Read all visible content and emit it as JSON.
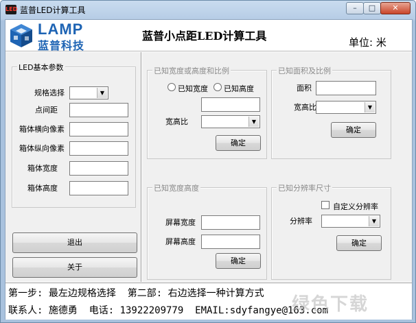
{
  "window": {
    "title": "蓝普LED计算工具",
    "icon_text": "LED",
    "controls": {
      "minimize": "–",
      "maximize": "□",
      "close": "✕"
    }
  },
  "header": {
    "logo_en": "LAMP",
    "logo_cn": "蓝普科技",
    "app_title": "蓝普小点距LED计算工具",
    "unit": "单位: 米"
  },
  "led_params": {
    "title": "LED基本参数",
    "spec_label": "规格选择",
    "spec_value": "",
    "pitch_label": "点间距",
    "pitch_value": "",
    "h_pixels_label": "箱体横向像素",
    "h_pixels_value": "",
    "v_pixels_label": "箱体纵向像素",
    "v_pixels_value": "",
    "cab_width_label": "箱体宽度",
    "cab_width_value": "",
    "cab_height_label": "箱体高度",
    "cab_height_value": ""
  },
  "buttons": {
    "exit": "退出",
    "about": "关于"
  },
  "group_wh_ratio": {
    "title": "已知宽度或高度和比例",
    "radio_width": "已知宽度",
    "radio_height": "已知高度",
    "value": "",
    "ratio_label": "宽高比",
    "ratio_value": "",
    "confirm": "确定"
  },
  "group_area_ratio": {
    "title": "已知面积及比例",
    "area_label": "面积",
    "area_value": "",
    "ratio_label": "宽高比",
    "ratio_value": "",
    "confirm": "确定"
  },
  "group_wh": {
    "title": "已知宽度高度",
    "width_label": "屏幕宽度",
    "width_value": "",
    "height_label": "屏幕高度",
    "height_value": "",
    "confirm": "确定"
  },
  "group_resolution": {
    "title": "已知分辨率尺寸",
    "custom_label": "自定义分辨率",
    "resolution_label": "分辨率",
    "resolution_value": "",
    "confirm": "确定"
  },
  "footer": {
    "line1": "第一步: 最左边规格选择  第二部: 右边选择一种计算方式",
    "line2": "联系人: 施德勇  电话: 13922209779  EMAIL:sdyfangye@163.com",
    "watermark": "绿色下载"
  },
  "colors": {
    "brand_blue": "#1e64b4",
    "title_bar": "#b7cde6",
    "panel_bg": "#f0f0f0"
  }
}
